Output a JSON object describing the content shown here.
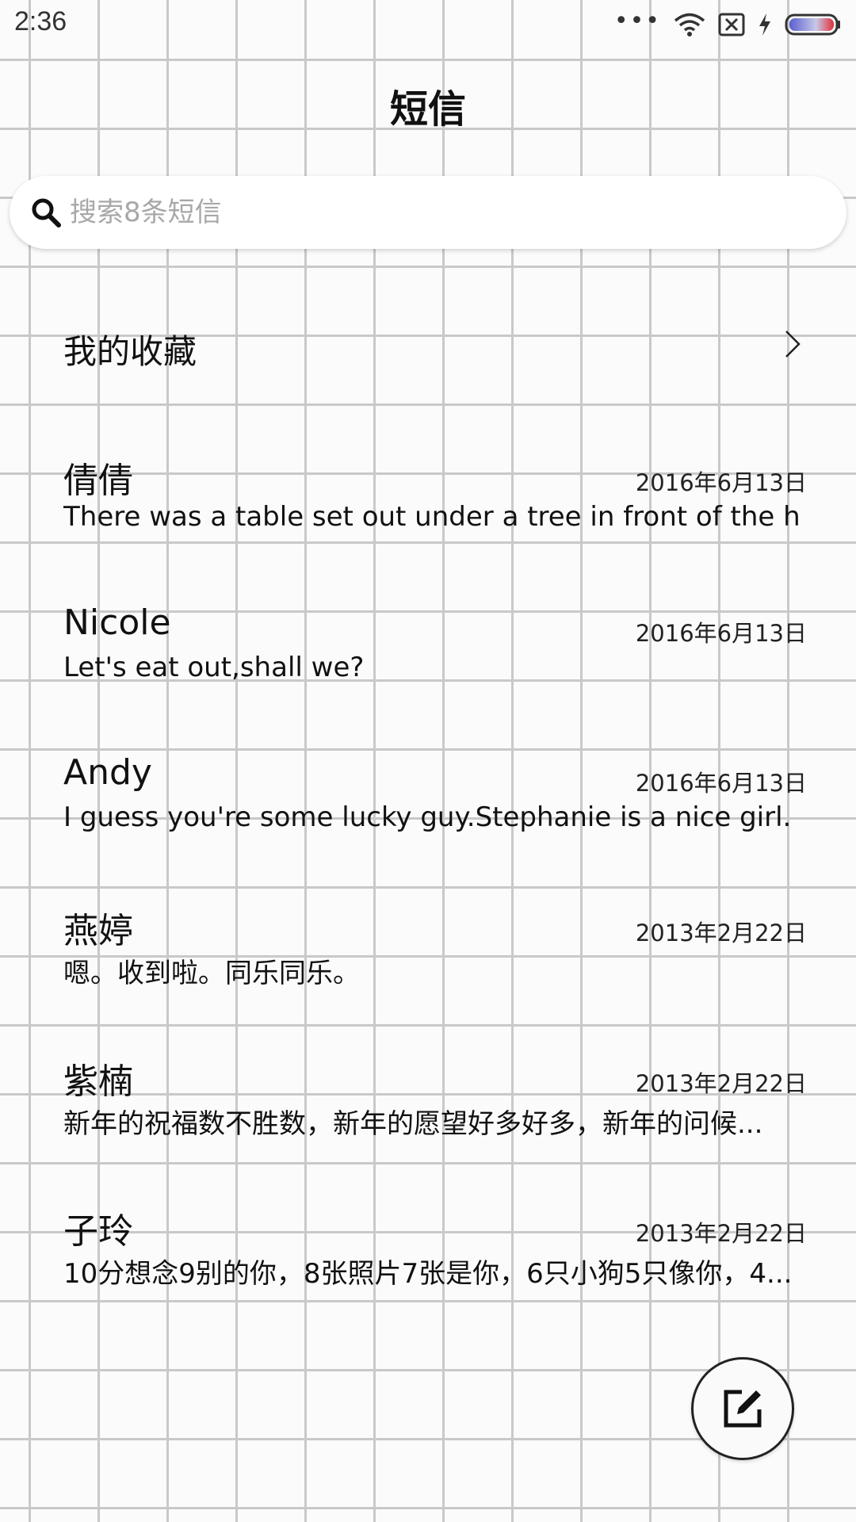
{
  "status_bar": {
    "time": "2:36",
    "dots": "•••"
  },
  "header": {
    "title": "短信"
  },
  "search": {
    "placeholder": "搜索8条短信"
  },
  "favorites": {
    "label": "我的收藏"
  },
  "conversations": [
    {
      "name": "倩倩",
      "date": "2016年6月13日",
      "preview": "There was a table set out under a tree in front of the ho..."
    },
    {
      "name": "Nicole",
      "date": "2016年6月13日",
      "preview": "Let's eat out,shall we?"
    },
    {
      "name": "Andy",
      "date": "2016年6月13日",
      "preview": "I guess you're some lucky guy.Stephanie is a nice girl."
    },
    {
      "name": "燕婷",
      "date": "2013年2月22日",
      "preview": "嗯。收到啦。同乐同乐。"
    },
    {
      "name": "紫楠",
      "date": "2013年2月22日",
      "preview": "新年的祝福数不胜数，新年的愿望好多好多，新年的问候..."
    },
    {
      "name": "子玲",
      "date": "2013年2月22日",
      "preview": "10分想念9别的你，8张照片7张是你，6只小狗5只像你，4..."
    }
  ],
  "icons": {
    "search": "search-icon",
    "chevron": "chevron-right-icon",
    "compose": "compose-icon",
    "wifi": "wifi-icon",
    "sim": "no-sim-icon",
    "charging": "charging-icon",
    "battery": "battery-icon"
  },
  "colors": {
    "background": "#fbfbfb",
    "grid": "#c9c9c9",
    "text": "#111111",
    "placeholder": "#a8a8a8",
    "battery_fill_start": "#5a5fd0",
    "battery_fill_end": "#e0303a"
  }
}
